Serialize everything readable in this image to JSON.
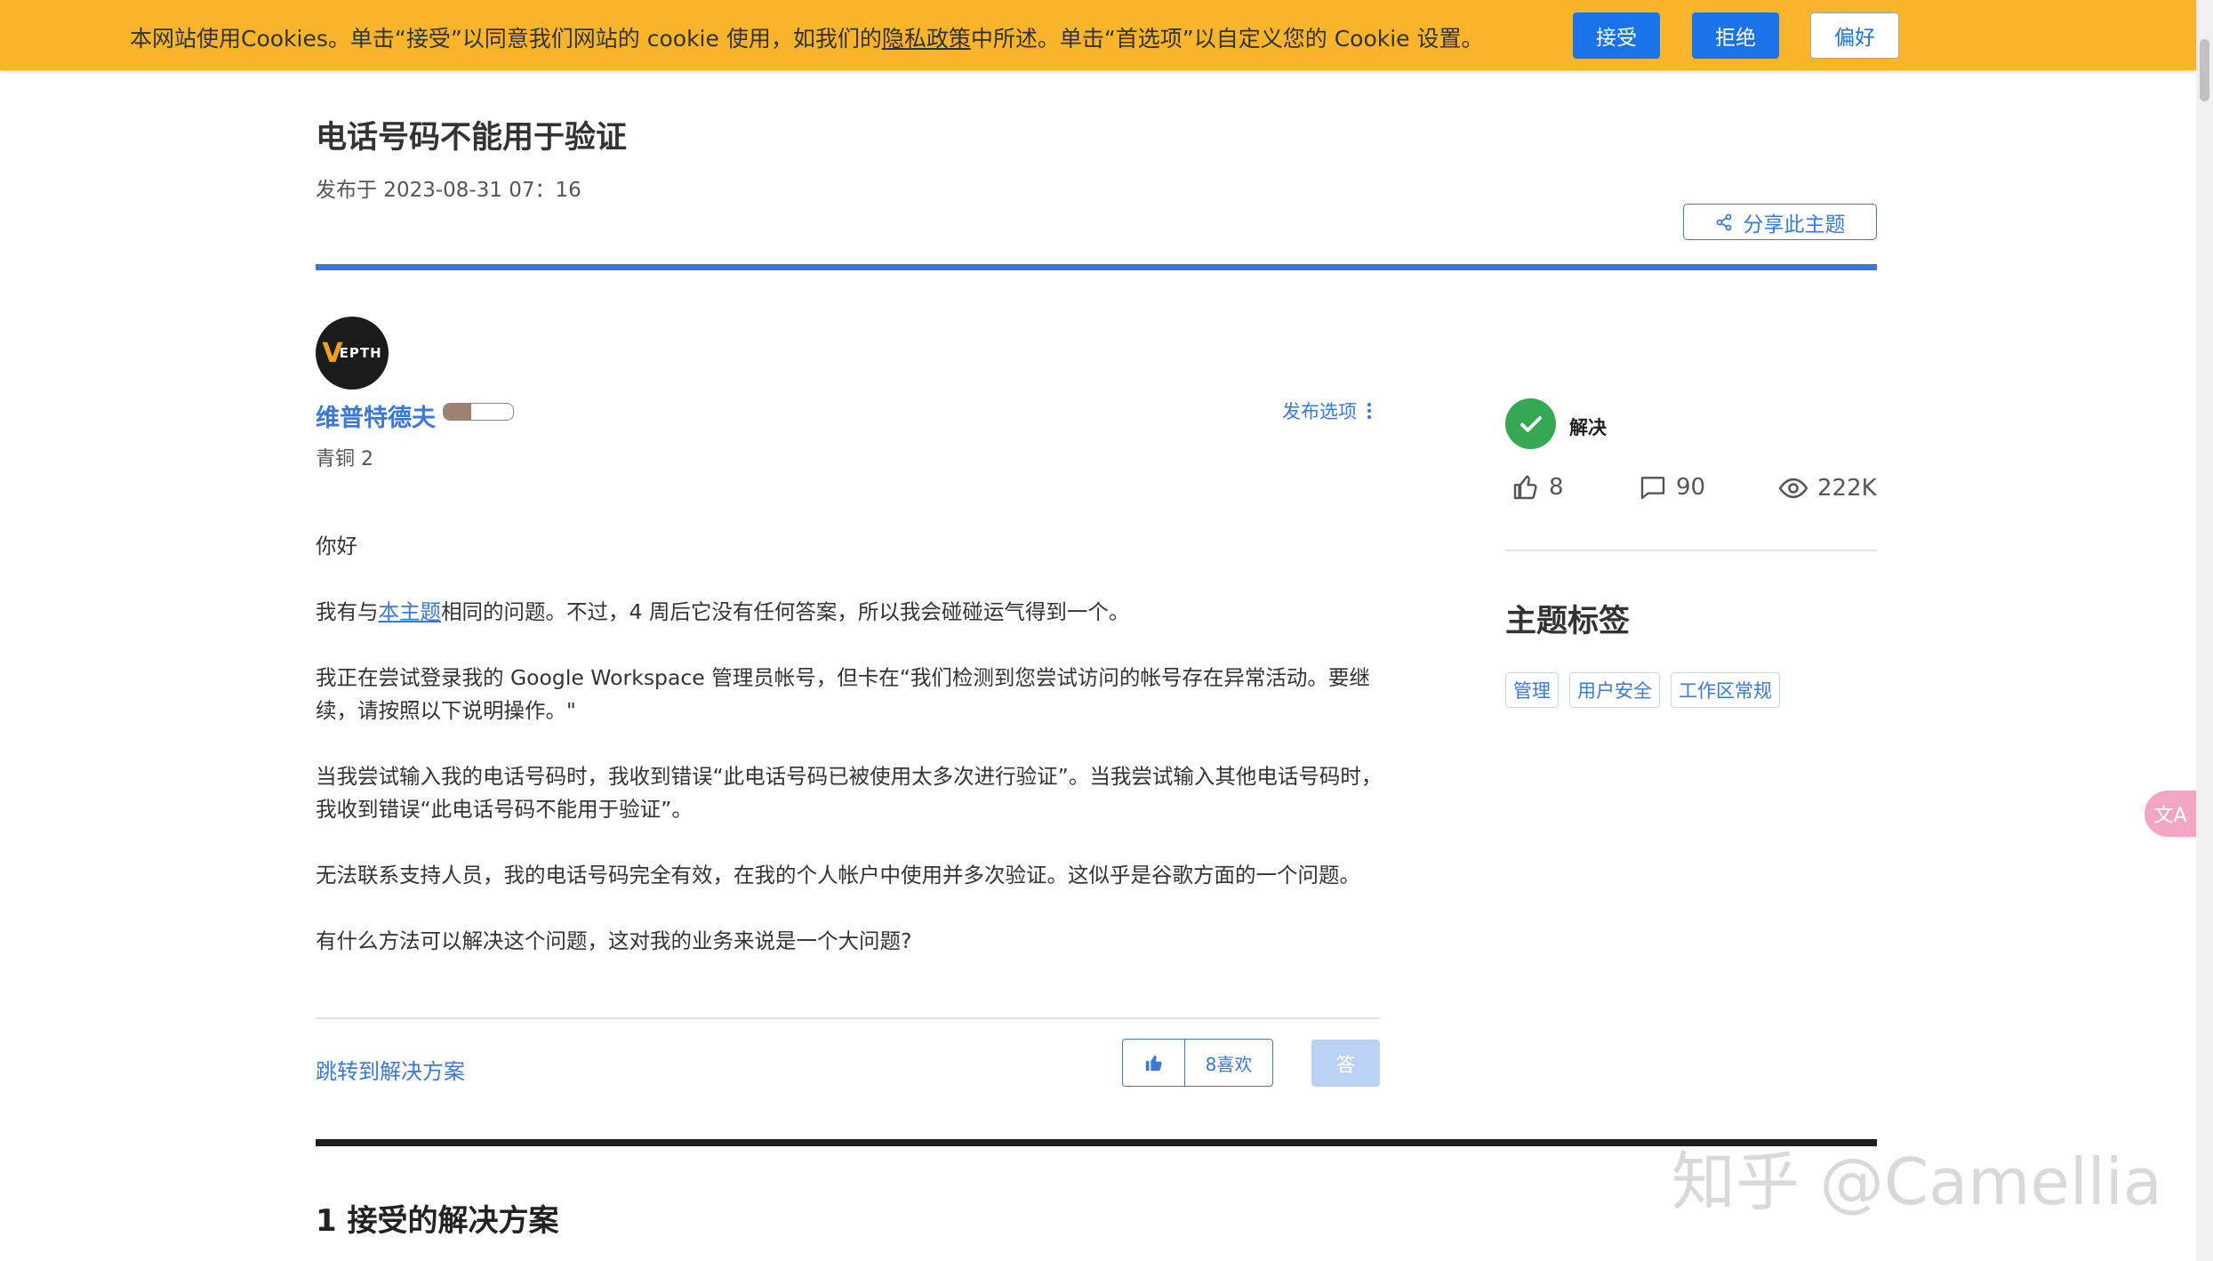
{
  "cookie_banner": {
    "text_before": "本网站使用Cookies。单击“接受”以同意我们网站的 cookie 使用，如我们的",
    "privacy_link": "隐私政策",
    "text_after": "中所述。单击“首选项”以自定义您的 Cookie 设置。",
    "accept_label": "接受",
    "reject_label": "拒绝",
    "preferences_label": "偏好"
  },
  "post": {
    "title": "电话号码不能用于验证",
    "date": "发布于 2023-08-31 07：16",
    "share_label": "分享此主题",
    "author": {
      "name": "维普特德夫",
      "rank": "青铜 2",
      "rank_progress": 0.4,
      "avatar_text": "EPTH",
      "avatar_mark": "V"
    },
    "options_label": "发布选项",
    "body": {
      "p1": "你好",
      "p2_before": "我有与",
      "p2_link": "本主题",
      "p2_after": "相同的问题。不过，4 周后它没有任何答案，所以我会碰碰运气得到一个。",
      "p3": "我正在尝试登录我的 Google Workspace 管理员帐号，但卡在“我们检测到您尝试访问的帐号存在异常活动。要继续，请按照以下说明操作。\"",
      "p4": "当我尝试输入我的电话号码时，我收到错误“此电话号码已被使用太多次进行验证”。当我尝试输入其他电话号码时，我收到错误“此电话号码不能用于验证”。",
      "p5": "无法联系支持人员，我的电话号码完全有效，在我的个人帐户中使用并多次验证。这似乎是谷歌方面的一个问题。",
      "p6": "有什么方法可以解决这个问题，这对我的业务来说是一个大问题?"
    },
    "jump_label": "跳转到解决方案",
    "like_label": "8喜欢",
    "answer_label": "答",
    "solutions_heading": "1 接受的解决方案"
  },
  "sidebar": {
    "solved_label": "解决",
    "likes": "8",
    "replies": "90",
    "views": "222K",
    "tags_heading": "主题标签",
    "tags": [
      "管理",
      "用户安全",
      "工作区常规"
    ]
  },
  "translate_icon_text": "文A",
  "watermark": "知乎 @Camellia",
  "colors": {
    "banner": "#f8b52c",
    "accent": "#3b78d8",
    "solved": "#34a853"
  }
}
